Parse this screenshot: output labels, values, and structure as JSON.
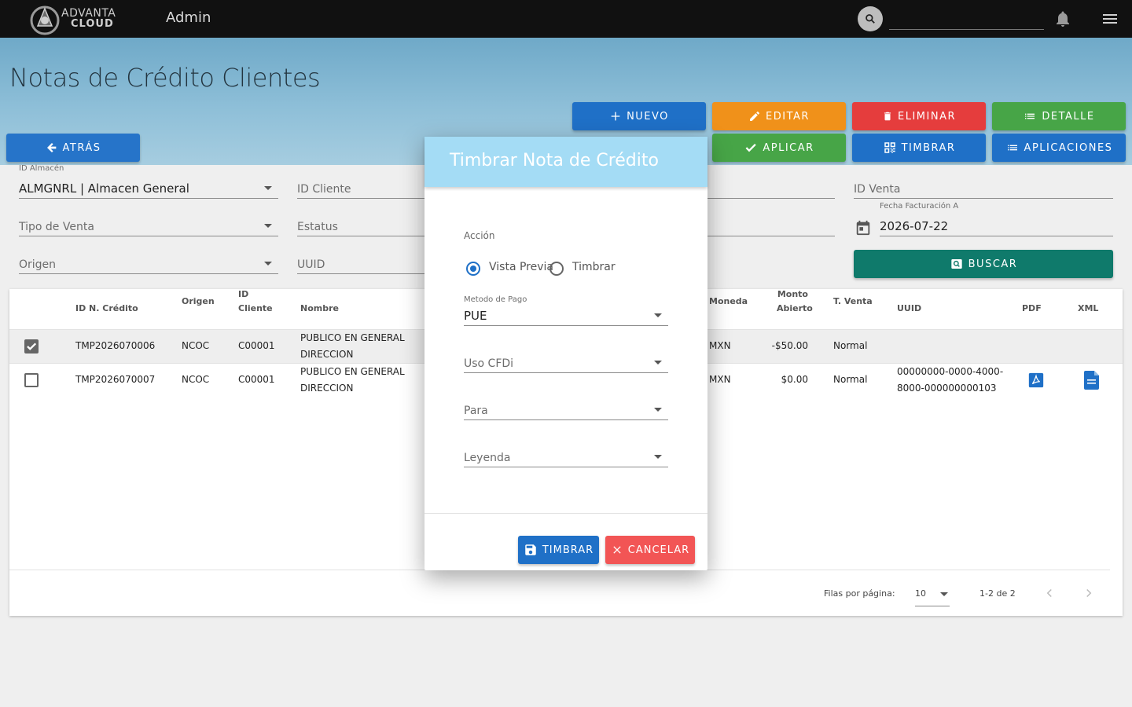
{
  "topbar": {
    "logo_line1": "ADVANTA",
    "logo_line2": "CLOUD",
    "app_title": "Admin",
    "search_placeholder": ""
  },
  "page": {
    "title": "Notas de Crédito Clientes"
  },
  "toolbar": {
    "nuevo": "Nuevo",
    "editar": "Editar",
    "eliminar": "Eliminar",
    "detalle": "Detalle",
    "atras": "Atrás",
    "aplicar": "Aplicar",
    "timbrar": "Timbrar",
    "aplicaciones": "Aplicaciones",
    "buscar": "Buscar"
  },
  "filters": {
    "almacen_label": "ID Almacén",
    "almacen_value": "ALMGNRL | Almacen General",
    "cliente_placeholder": "ID Cliente",
    "venta_placeholder": "ID Venta",
    "tipo_venta_placeholder": "Tipo de Venta",
    "estatus_placeholder": "Estatus",
    "fecha_label": "Fecha Facturación A",
    "fecha_value": "2026-07-22",
    "origen_placeholder": "Origen",
    "uuid_placeholder": "UUID"
  },
  "table": {
    "headers": {
      "id": "ID N. Crédito",
      "origen": "Origen",
      "cliente_1": "ID",
      "cliente_2": "Cliente",
      "nombre": "Nombre",
      "moneda": "Moneda",
      "monto_1": "Monto",
      "monto_2": "Abierto",
      "tventa": "T. Venta",
      "uuid": "UUID",
      "pdf": "PDF",
      "xml": "XML"
    },
    "rows": [
      {
        "checked": true,
        "id": "TMP2026070006",
        "origen": "NCOC",
        "cliente": "C00001",
        "nombre_1": "PUBLICO EN GENERAL",
        "nombre_2": "DIRECCION",
        "moneda": "MXN",
        "monto": "-$50.00",
        "tventa": "Normal",
        "uuid_1": "",
        "uuid_2": ""
      },
      {
        "checked": false,
        "id": "TMP2026070007",
        "origen": "NCOC",
        "cliente": "C00001",
        "nombre_1": "PUBLICO EN GENERAL",
        "nombre_2": "DIRECCION",
        "moneda": "MXN",
        "monto": "$0.00",
        "tventa": "Normal",
        "uuid_1": "00000000-0000-4000-",
        "uuid_2": "8000-000000000103"
      }
    ],
    "footer": {
      "rows_per_page_label": "Filas por página:",
      "rows_per_page_value": "10",
      "range": "1-2 de 2"
    }
  },
  "dialog": {
    "title": "Timbrar Nota de Crédito",
    "accion_label": "Acción",
    "option_preview": "Vista Previa",
    "option_timbrar": "Timbrar",
    "selected_option": "Vista Previa",
    "metodo_label": "Metodo de Pago",
    "metodo_value": "PUE",
    "uso_placeholder": "Uso CFDi",
    "para_placeholder": "Para",
    "leyenda_placeholder": "Leyenda",
    "timbrar_button": "Timbrar",
    "cancelar_button": "Cancelar"
  },
  "colors": {
    "topbar": "#111111",
    "primary": "#1f70c7",
    "orange": "#f0911a",
    "red": "#e53d3d",
    "green": "#47a547",
    "teal": "#0f7a6b",
    "dialog_header": "#a4dcf5"
  }
}
